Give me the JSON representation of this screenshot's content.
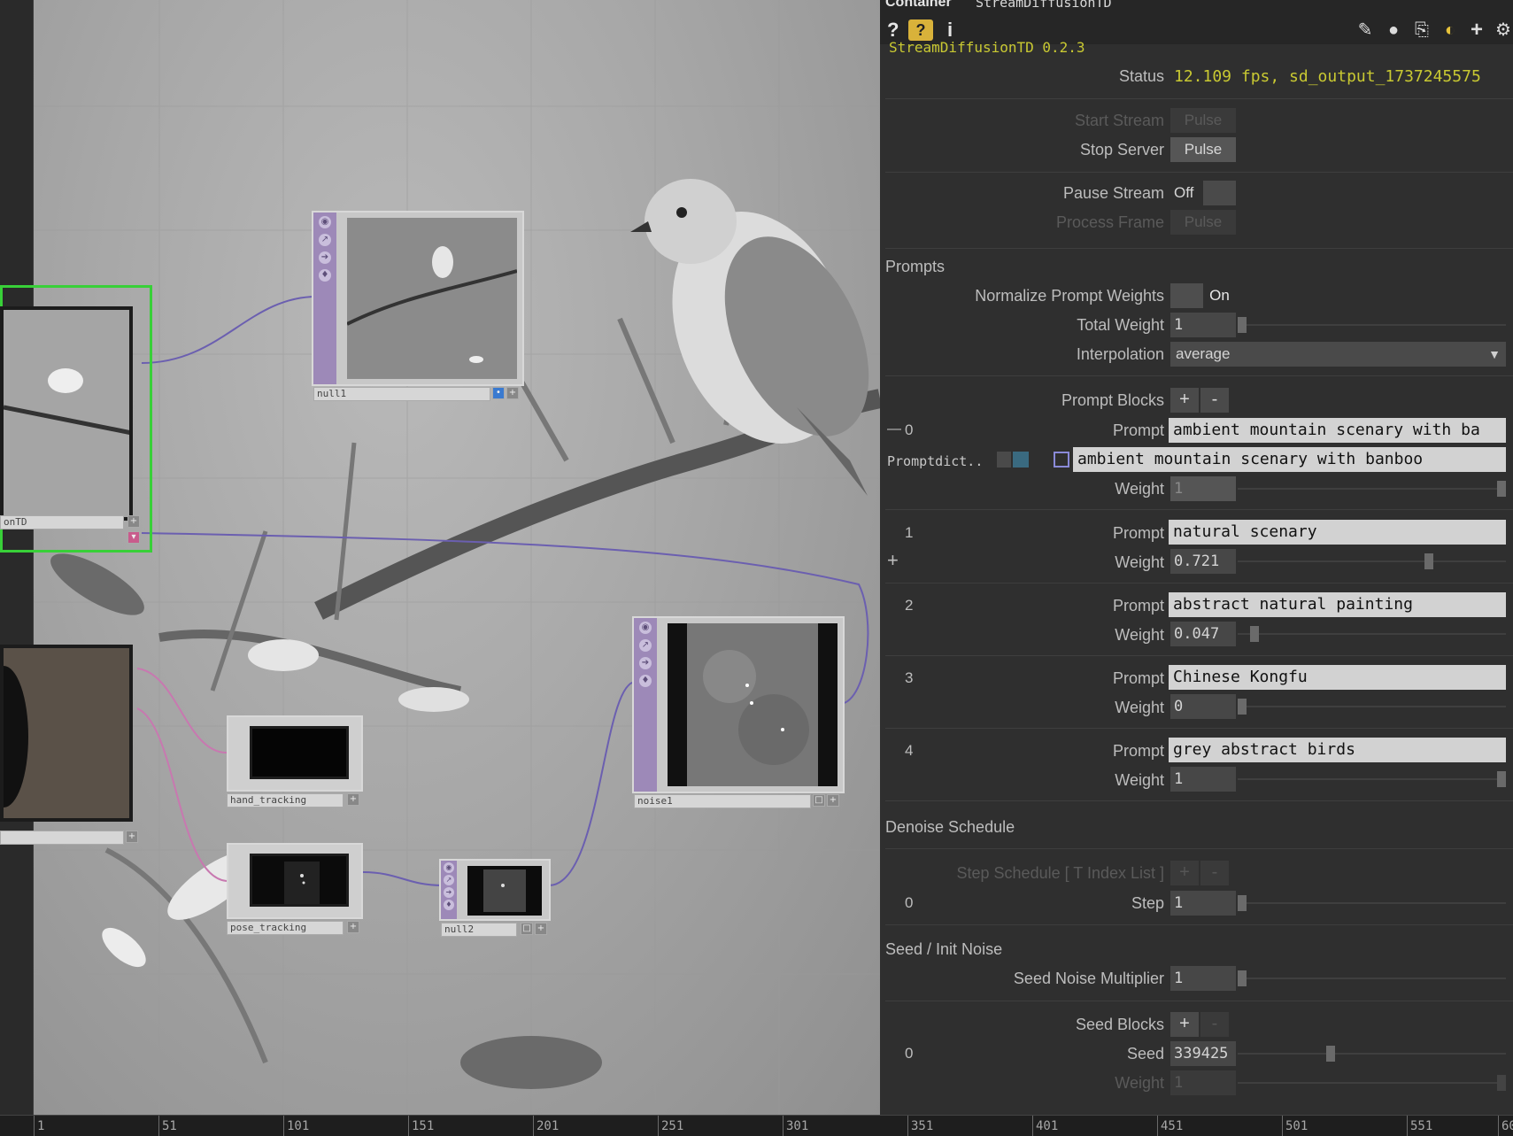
{
  "header": {
    "title_label": "Container",
    "title_value": "StreamDiffusionTD",
    "icons": [
      "help-icon",
      "python-help-icon",
      "info-icon",
      "edit-icon",
      "comment-icon",
      "clone-icon",
      "python-icon",
      "add-icon",
      "gear-icon"
    ]
  },
  "network": {
    "nodes": {
      "left_partial": "onTD",
      "null1": "null1",
      "hand_tracking": "hand_tracking",
      "pose_tracking": "pose_tracking",
      "null2": "null2",
      "noise1": "noise1"
    }
  },
  "params": {
    "version": "StreamDiffusionTD 0.2.3",
    "status": {
      "label": "Status",
      "value": "12.109 fps, sd_output_1737245575"
    },
    "start_stream": {
      "label": "Start Stream",
      "button": "Pulse"
    },
    "stop_server": {
      "label": "Stop Server",
      "button": "Pulse"
    },
    "pause_stream": {
      "label": "Pause Stream",
      "value": "Off"
    },
    "process_frame": {
      "label": "Process Frame",
      "button": "Pulse"
    },
    "prompts_section": "Prompts",
    "normalize": {
      "label": "Normalize Prompt Weights",
      "value": "On"
    },
    "total_weight": {
      "label": "Total Weight",
      "value": "1"
    },
    "interpolation": {
      "label": "Interpolation",
      "value": "average"
    },
    "prompt_blocks": {
      "label": "Prompt Blocks",
      "add": "+",
      "remove": "-"
    },
    "prompt_dict_label": "Promptdict..",
    "prompt_dict_value": "ambient mountain scenary with banboo",
    "prompt_label": "Prompt",
    "weight_label": "Weight",
    "prompts": [
      {
        "index": "0",
        "prompt": "ambient mountain scenary with ba",
        "weight": "1",
        "weight_fraction": 1.0
      },
      {
        "index": "1",
        "prompt": "natural scenary",
        "weight": "0.721",
        "weight_fraction": 0.721
      },
      {
        "index": "2",
        "prompt": "abstract natural painting",
        "weight": "0.047",
        "weight_fraction": 0.047
      },
      {
        "index": "3",
        "prompt": "Chinese Kongfu",
        "weight": "0",
        "weight_fraction": 0.0
      },
      {
        "index": "4",
        "prompt": "grey abstract birds",
        "weight": "1",
        "weight_fraction": 1.0
      }
    ],
    "denoise_section": "Denoise Schedule",
    "step_schedule": {
      "label": "Step Schedule [ T Index List ]",
      "add": "+",
      "remove": "-"
    },
    "step": {
      "index": "0",
      "label": "Step",
      "value": "1"
    },
    "seed_section": "Seed / Init Noise",
    "seed_noise": {
      "label": "Seed Noise Multiplier",
      "value": "1"
    },
    "seed_blocks": {
      "label": "Seed Blocks",
      "add": "+",
      "remove": "-"
    },
    "seed": {
      "index": "0",
      "label": "Seed",
      "value": "339425"
    },
    "seed_weight": {
      "label": "Weight",
      "value": "1"
    }
  },
  "timeline": {
    "ticks": [
      "1",
      "51",
      "101",
      "151",
      "201",
      "251",
      "301",
      "351",
      "401",
      "451",
      "501",
      "551",
      "60"
    ]
  },
  "colors": {
    "accent_green": "#38d038",
    "status_yellow": "#c9c932",
    "operator_purple": "#9d89b8",
    "wire_blue": "#6b5fb0",
    "wire_pink": "#c878b0"
  }
}
